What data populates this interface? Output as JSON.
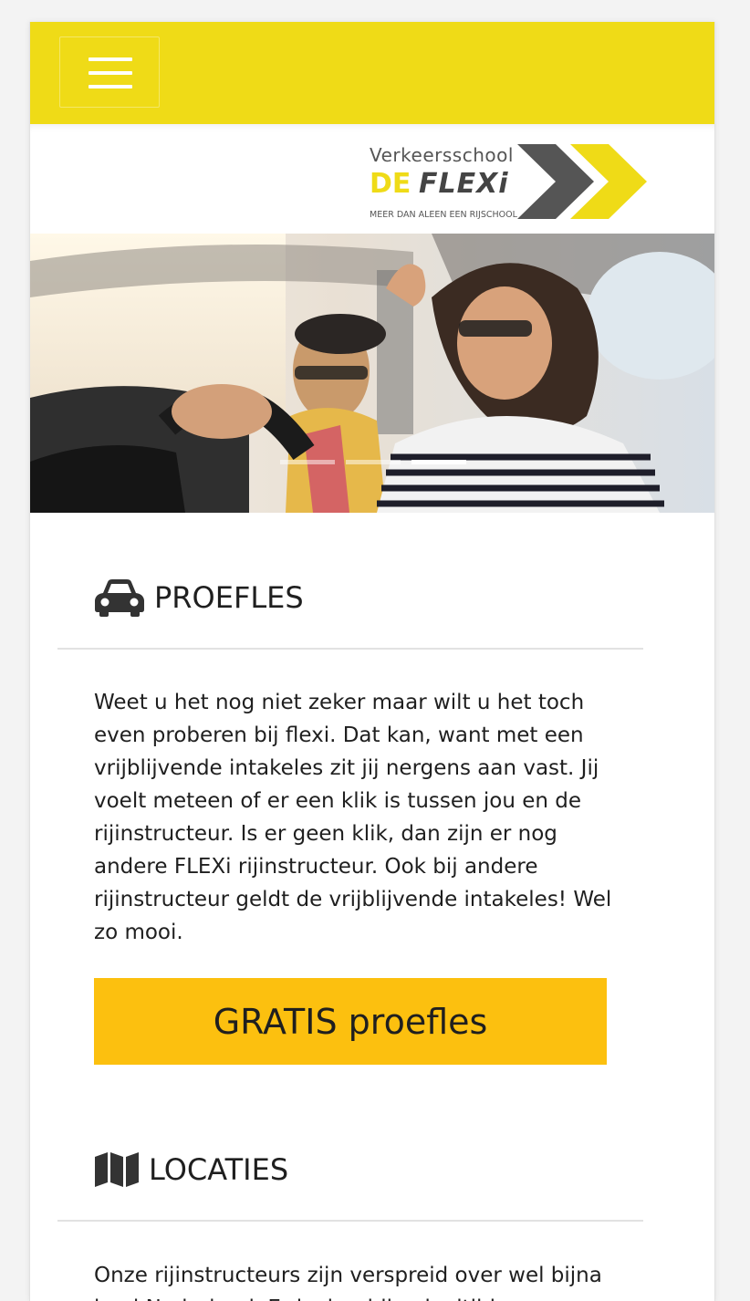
{
  "navbar": {
    "menu_icon": "hamburger-menu-icon"
  },
  "logo": {
    "top_word": "Verkeersschool",
    "de": "DE",
    "flexi": "FLEXi",
    "tagline": "MEER DAN ALEEN EEN RIJSCHOOL"
  },
  "carousel": {
    "slide_count": 3,
    "active_index": 2
  },
  "sections": {
    "proefles": {
      "icon": "car-icon",
      "title": "PROEFLES",
      "text": "Weet u het nog niet zeker maar wilt u het toch even proberen bij flexi. Dat kan, want met een vrijblijvende intakeles zit jij nergens aan vast. Jij voelt meteen of er een klik is tussen jou en de rijinstructeur. Is er geen klik, dan zijn er nog andere FLEXi rijinstructeur. Ook bij andere rijinstructeur geldt de vrijblijvende intakeles! Wel zo mooi.",
      "button_label": "GRATIS proefles"
    },
    "locaties": {
      "icon": "map-icon",
      "title": "LOCATIES",
      "text": "Onze rijinstructeurs zijn verspreid over wel bijna heel Nederland. Er is daarbij ook altijd"
    }
  },
  "colors": {
    "brand_yellow": "#efdb17",
    "cta_yellow": "#fcc00f",
    "logo_gray": "#555555"
  }
}
